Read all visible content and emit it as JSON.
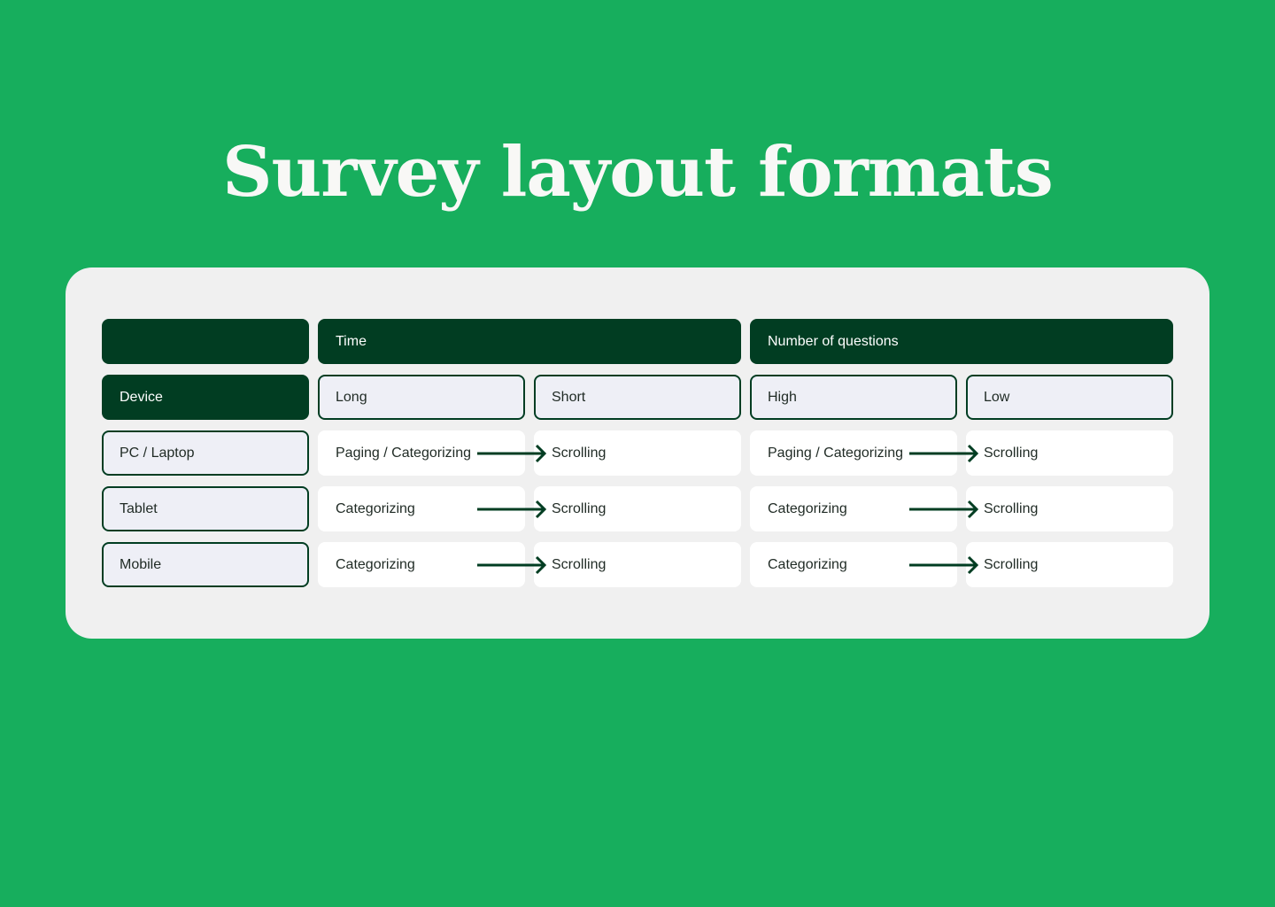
{
  "title": "Survey layout formats",
  "table": {
    "corner_label": "",
    "groups": [
      {
        "label": "Time",
        "sub": [
          "Long",
          "Short"
        ]
      },
      {
        "label": "Number of questions",
        "sub": [
          "High",
          "Low"
        ]
      }
    ],
    "row_header_label": "Device",
    "rows": [
      {
        "device": "PC / Laptop",
        "time_from": "Paging / Categorizing",
        "time_to": "Scrolling",
        "num_from": "Paging / Categorizing",
        "num_to": "Scrolling"
      },
      {
        "device": "Tablet",
        "time_from": "Categorizing",
        "time_to": "Scrolling",
        "num_from": "Categorizing",
        "num_to": "Scrolling"
      },
      {
        "device": "Mobile",
        "time_from": "Categorizing",
        "time_to": "Scrolling",
        "num_from": "Categorizing",
        "num_to": "Scrolling"
      }
    ]
  },
  "colors": {
    "background": "#17ae5d",
    "dark": "#013d22",
    "card": "#f0f0f0",
    "header_cell": "#eeeff6"
  }
}
